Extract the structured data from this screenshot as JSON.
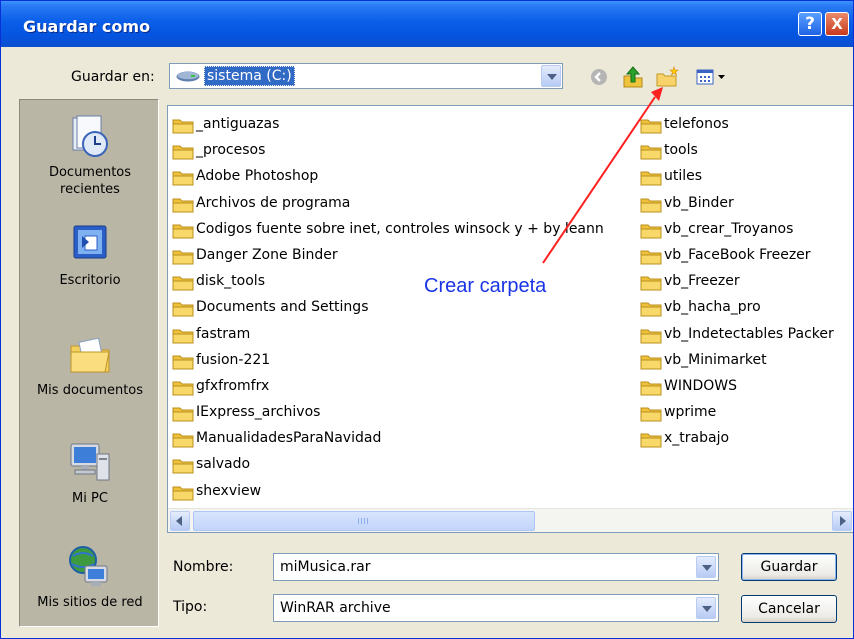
{
  "window": {
    "title": "Guardar como",
    "help_glyph": "?",
    "close_glyph": "X"
  },
  "toolbar": {
    "save_in_label": "Guardar en:",
    "save_in_value": "sistema (C:)",
    "icons": [
      "back-icon",
      "up-folder-icon",
      "new-folder-icon",
      "views-menu-icon"
    ]
  },
  "places": [
    {
      "label": "Documentos recientes",
      "icon": "recent-documents-icon"
    },
    {
      "label": "Escritorio",
      "icon": "desktop-icon"
    },
    {
      "label": "Mis documentos",
      "icon": "my-documents-icon"
    },
    {
      "label": "Mi PC",
      "icon": "my-computer-icon"
    },
    {
      "label": "Mis sitios de red",
      "icon": "network-places-icon"
    }
  ],
  "files_col1": [
    "_antiguazas",
    "_procesos",
    "Adobe Photoshop",
    "Archivos de programa",
    "Codigos fuente sobre inet, controles winsock y + by leann",
    "Danger Zone Binder",
    "disk_tools",
    "Documents and Settings",
    "fastram",
    "fusion-221",
    "gfxfromfrx",
    "IExpress_archivos",
    "ManualidadesParaNavidad",
    "salvado",
    "shexview"
  ],
  "files_col2": [
    "telefonos",
    "tools",
    "utiles",
    "vb_Binder",
    "vb_crear_Troyanos",
    "vb_FaceBook Freezer",
    "vb_Freezer",
    "vb_hacha_pro",
    "vb_Indetectables Packer",
    "vb_Minimarket",
    "WINDOWS",
    "wprime",
    "x_trabajo"
  ],
  "form": {
    "filename_label": "Nombre:",
    "filename_value": "miMusica.rar",
    "filetype_label": "Tipo:",
    "filetype_value": "WinRAR archive"
  },
  "buttons": {
    "save": "Guardar",
    "cancel": "Cancelar"
  },
  "annotation": {
    "text": "Crear carpeta",
    "color": "#1a34e6",
    "arrow_color": "#ff2020"
  },
  "colors": {
    "titlebar": "#0a5ee8",
    "selection": "#316ac5",
    "dialog_bg": "#ece9d8",
    "places_bg": "#b9b6a6"
  }
}
